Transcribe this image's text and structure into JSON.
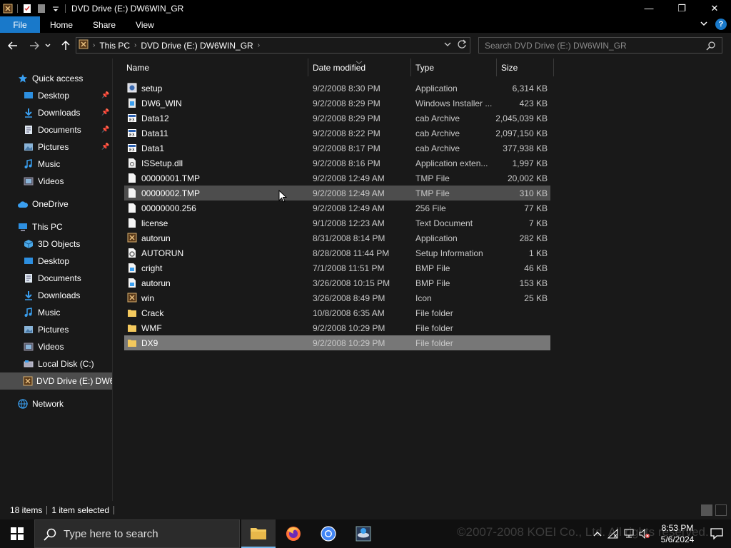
{
  "window": {
    "title": "DVD Drive (E:) DW6WIN_GR",
    "minimize": "—",
    "maximize": "❐",
    "close": "✕"
  },
  "ribbon": {
    "tabs": [
      "File",
      "Home",
      "Share",
      "View"
    ],
    "help": "?"
  },
  "address": {
    "segments": [
      "This PC",
      "DVD Drive (E:) DW6WIN_GR"
    ],
    "search_placeholder": "Search DVD Drive (E:) DW6WIN_GR"
  },
  "sidebar": {
    "items": [
      {
        "label": "Quick access",
        "icon": "star-icon",
        "pinned": false
      },
      {
        "label": "Desktop",
        "icon": "desktop-icon",
        "pinned": true
      },
      {
        "label": "Downloads",
        "icon": "download-icon",
        "pinned": true
      },
      {
        "label": "Documents",
        "icon": "document-icon",
        "pinned": true
      },
      {
        "label": "Pictures",
        "icon": "pictures-icon",
        "pinned": true
      },
      {
        "label": "Music",
        "icon": "music-icon",
        "pinned": false
      },
      {
        "label": "Videos",
        "icon": "video-icon",
        "pinned": false
      },
      {
        "label": "OneDrive",
        "icon": "cloud-icon",
        "pinned": false
      },
      {
        "label": "This PC",
        "icon": "computer-icon",
        "pinned": false
      },
      {
        "label": "3D Objects",
        "icon": "cube-icon",
        "pinned": false
      },
      {
        "label": "Desktop",
        "icon": "desktop-icon",
        "pinned": false
      },
      {
        "label": "Documents",
        "icon": "document-icon",
        "pinned": false
      },
      {
        "label": "Downloads",
        "icon": "download-icon",
        "pinned": false
      },
      {
        "label": "Music",
        "icon": "music-icon",
        "pinned": false
      },
      {
        "label": "Pictures",
        "icon": "pictures-icon",
        "pinned": false
      },
      {
        "label": "Videos",
        "icon": "video-icon",
        "pinned": false
      },
      {
        "label": "Local Disk (C:)",
        "icon": "disk-icon",
        "pinned": false
      },
      {
        "label": "DVD Drive (E:) DW6WIN_GR",
        "icon": "dvd-icon",
        "pinned": false
      },
      {
        "label": "Network",
        "icon": "network-icon",
        "pinned": false
      }
    ]
  },
  "columns": [
    "Name",
    "Date modified",
    "Type",
    "Size"
  ],
  "files": [
    {
      "name": "setup",
      "date": "9/2/2008 8:30 PM",
      "type": "Application",
      "size": "6,314 KB",
      "icon": "setup-app-icon"
    },
    {
      "name": "DW6_WIN",
      "date": "9/2/2008 8:29 PM",
      "type": "Windows Installer ...",
      "size": "423 KB",
      "icon": "installer-icon"
    },
    {
      "name": "Data12",
      "date": "9/2/2008 8:29 PM",
      "type": "cab Archive",
      "size": "2,045,039 KB",
      "icon": "cab-icon"
    },
    {
      "name": "Data11",
      "date": "9/2/2008 8:22 PM",
      "type": "cab Archive",
      "size": "2,097,150 KB",
      "icon": "cab-icon"
    },
    {
      "name": "Data1",
      "date": "9/2/2008 8:17 PM",
      "type": "cab Archive",
      "size": "377,938 KB",
      "icon": "cab-icon"
    },
    {
      "name": "ISSetup.dll",
      "date": "9/2/2008 8:16 PM",
      "type": "Application exten...",
      "size": "1,997 KB",
      "icon": "dll-icon"
    },
    {
      "name": "00000001.TMP",
      "date": "9/2/2008 12:49 AM",
      "type": "TMP File",
      "size": "20,002 KB",
      "icon": "file-icon"
    },
    {
      "name": "00000002.TMP",
      "date": "9/2/2008 12:49 AM",
      "type": "TMP File",
      "size": "310 KB",
      "icon": "file-icon"
    },
    {
      "name": "00000000.256",
      "date": "9/2/2008 12:49 AM",
      "type": "256 File",
      "size": "77 KB",
      "icon": "file-icon"
    },
    {
      "name": "license",
      "date": "9/1/2008 12:23 AM",
      "type": "Text Document",
      "size": "7 KB",
      "icon": "file-icon"
    },
    {
      "name": "autorun",
      "date": "8/31/2008 8:14 PM",
      "type": "Application",
      "size": "282 KB",
      "icon": "game-app-icon"
    },
    {
      "name": "AUTORUN",
      "date": "8/28/2008 11:44 PM",
      "type": "Setup Information",
      "size": "1 KB",
      "icon": "setup-info-icon"
    },
    {
      "name": "cright",
      "date": "7/1/2008 11:51 PM",
      "type": "BMP File",
      "size": "46 KB",
      "icon": "bmp-icon"
    },
    {
      "name": "autorun",
      "date": "3/26/2008 10:15 PM",
      "type": "BMP File",
      "size": "153 KB",
      "icon": "bmp-icon"
    },
    {
      "name": "win",
      "date": "3/26/2008 8:49 PM",
      "type": "Icon",
      "size": "25 KB",
      "icon": "game-app-icon"
    },
    {
      "name": "Crack",
      "date": "10/8/2008 6:35 AM",
      "type": "File folder",
      "size": "",
      "icon": "folder-icon"
    },
    {
      "name": "WMF",
      "date": "9/2/2008 10:29 PM",
      "type": "File folder",
      "size": "",
      "icon": "folder-icon"
    },
    {
      "name": "DX9",
      "date": "9/2/2008 10:29 PM",
      "type": "File folder",
      "size": "",
      "icon": "folder-icon"
    }
  ],
  "status": {
    "count": "18 items",
    "selected": "1 item selected"
  },
  "taskbar": {
    "search_placeholder": "Type here to search",
    "watermark": "©2007-2008 KOEI Co., Ltd. All rights reserved.",
    "time": "8:53 PM",
    "date": "5/6/2024"
  },
  "colors": {
    "accent": "#1979ca",
    "selected_row": "#777777",
    "hover_row": "#4d4d4d",
    "folder": "#f4c95d"
  }
}
